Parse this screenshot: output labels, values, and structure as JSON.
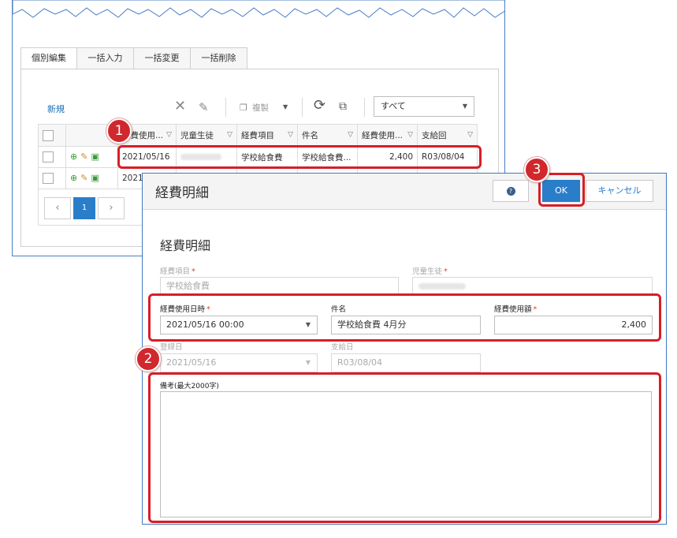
{
  "tabs": [
    {
      "label": "個別編集"
    },
    {
      "label": "一括入力"
    },
    {
      "label": "一括変更"
    },
    {
      "label": "一括削除"
    }
  ],
  "toolbar": {
    "new_label": "新規",
    "copy_label": "複製",
    "filter_value": "すべて"
  },
  "grid": {
    "headers": [
      "経費使用...",
      "児童生徒",
      "経費項目",
      "件名",
      "経費使用...",
      "支給回"
    ],
    "rows": [
      {
        "date": "2021/05/16",
        "item": "学校給食費",
        "subject": "学校給食費...",
        "amount": "2,400",
        "payment": "R03/08/04"
      },
      {
        "date": "2021"
      }
    ]
  },
  "pager": {
    "current_page": "1"
  },
  "dialog": {
    "title": "経費明細",
    "ok_label": "OK",
    "cancel_label": "キャンセル",
    "section_title": "経費明細",
    "fields": {
      "item_label": "経費項目",
      "item_value": "学校給食費",
      "student_label": "児童生徒",
      "date_label": "経費使用日時",
      "date_value": "2021/05/16 00:00",
      "subject_label": "件名",
      "subject_value": "学校給食費 4月分",
      "amount_label": "経費使用額",
      "amount_value": "2,400",
      "reg_label": "登録日",
      "reg_value": "2021/05/16",
      "payment_label": "支給日",
      "payment_value": "R03/08/04",
      "memo_label": "備考(最大2000字)"
    },
    "required_mark": "*"
  },
  "annotations": {
    "badge1": "1",
    "badge2": "2",
    "badge3": "3",
    "color": "#d81e26"
  }
}
